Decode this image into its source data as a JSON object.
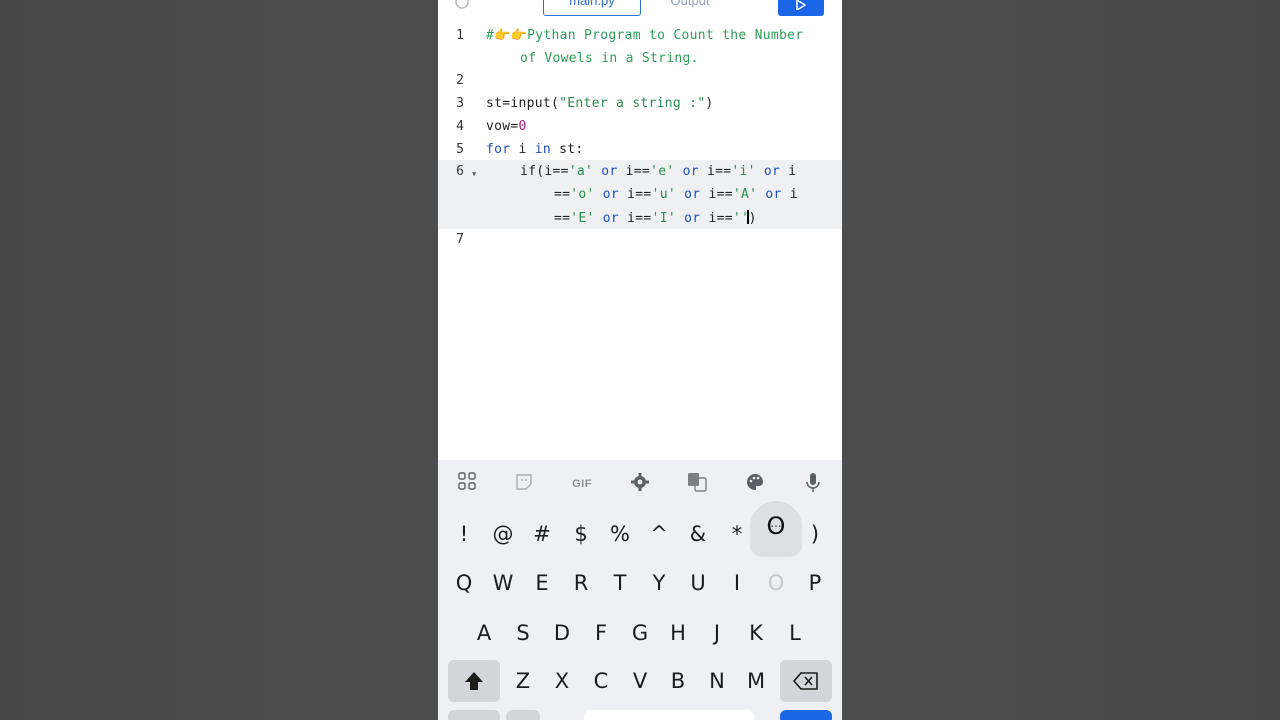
{
  "tabs": [
    {
      "label": "main.py",
      "active": true
    },
    {
      "label": "Output",
      "active": false
    }
  ],
  "icons": {
    "history": "history-icon",
    "run": "play-icon"
  },
  "editor": {
    "line_numbers": [
      "1",
      "2",
      "3",
      "4",
      "5",
      "6",
      "7"
    ],
    "lines": {
      "l1a": "#👉👉Pythan Program to Count the Number",
      "l1b": "of Vowels in a String.",
      "l3a": "st=input(",
      "l3b": "\"Enter a string :\"",
      "l3c": ")",
      "l4a": "vow=",
      "l4b": "0",
      "l5a": "for",
      "l5b": " i ",
      "l5c": "in",
      "l5d": " st:",
      "l6a1": "if(i==",
      "l6a2": "'a'",
      "l6a3": " or ",
      "l6a4": "i==",
      "l6a5": "'e'",
      "l6a6": " or ",
      "l6a7": "i==",
      "l6a8": "'i'",
      "l6a9": " or ",
      "l6a10": "i",
      "l6b1": "==",
      "l6b2": "'o'",
      "l6b3": " or ",
      "l6b4": "i==",
      "l6b5": "'u'",
      "l6b6": " or ",
      "l6b7": "i==",
      "l6b8": "'A'",
      "l6b9": " or ",
      "l6b10": "i",
      "l6c1": "==",
      "l6c2": "'E'",
      "l6c3": " or ",
      "l6c4": "i==",
      "l6c5": "'I'",
      "l6c6": " or ",
      "l6c7": "i==",
      "l6c8": "''",
      "l6c9": ")"
    }
  },
  "keyboard": {
    "toolbar": {
      "apps": "apps-grid-icon",
      "sticker": "sticker-icon",
      "gif_label": "GIF",
      "settings": "gear-icon",
      "translate": "translate-icon",
      "theme": "palette-icon",
      "mic": "microphone-icon"
    },
    "row_symbols": [
      "!",
      "@",
      "#",
      "$",
      "%",
      "^",
      "&",
      "*",
      "(",
      ")"
    ],
    "row_q": [
      "Q",
      "W",
      "E",
      "R",
      "T",
      "Y",
      "U",
      "I",
      "O",
      "P"
    ],
    "row_a": [
      "A",
      "S",
      "D",
      "F",
      "G",
      "H",
      "J",
      "K",
      "L"
    ],
    "row_z": [
      "Z",
      "X",
      "C",
      "V",
      "B",
      "N",
      "M"
    ],
    "popup_key": "O",
    "popup_dots": "..."
  },
  "colors": {
    "accent": "#1a66e6",
    "comment": "#2e9e5b",
    "keyword": "#1f4fbf",
    "number": "#a11d6b"
  }
}
